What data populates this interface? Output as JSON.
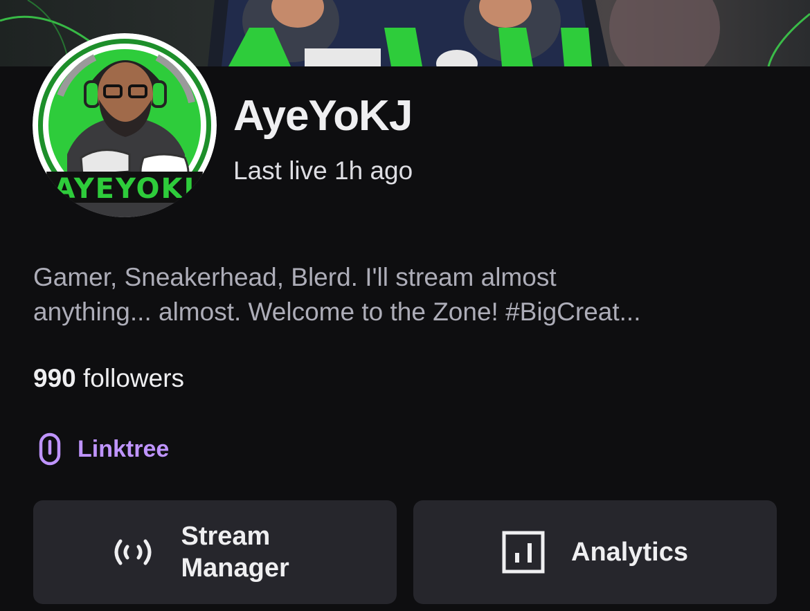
{
  "profile": {
    "channel_name": "AyeYoKJ",
    "last_live": "Last live 1h ago",
    "avatar_text": "AYEYOKJ",
    "bio_lines": [
      "Gamer, Sneakerhead, Blerd. I'll stream almost",
      "anything... almost. Welcome to the Zone! #BigCreat..."
    ],
    "followers_count": "990",
    "followers_label": "followers"
  },
  "links": [
    {
      "label": "Linktree",
      "icon": "link-icon"
    }
  ],
  "actions": {
    "stream_manager": {
      "label": "Stream Manager",
      "icon": "broadcast-icon"
    },
    "analytics": {
      "label": "Analytics",
      "icon": "bar-chart-icon"
    }
  },
  "colors": {
    "background": "#0e0e10",
    "link_purple": "#bf94ff",
    "button_bg": "#26262c",
    "brand_green": "#2ecc3b"
  }
}
